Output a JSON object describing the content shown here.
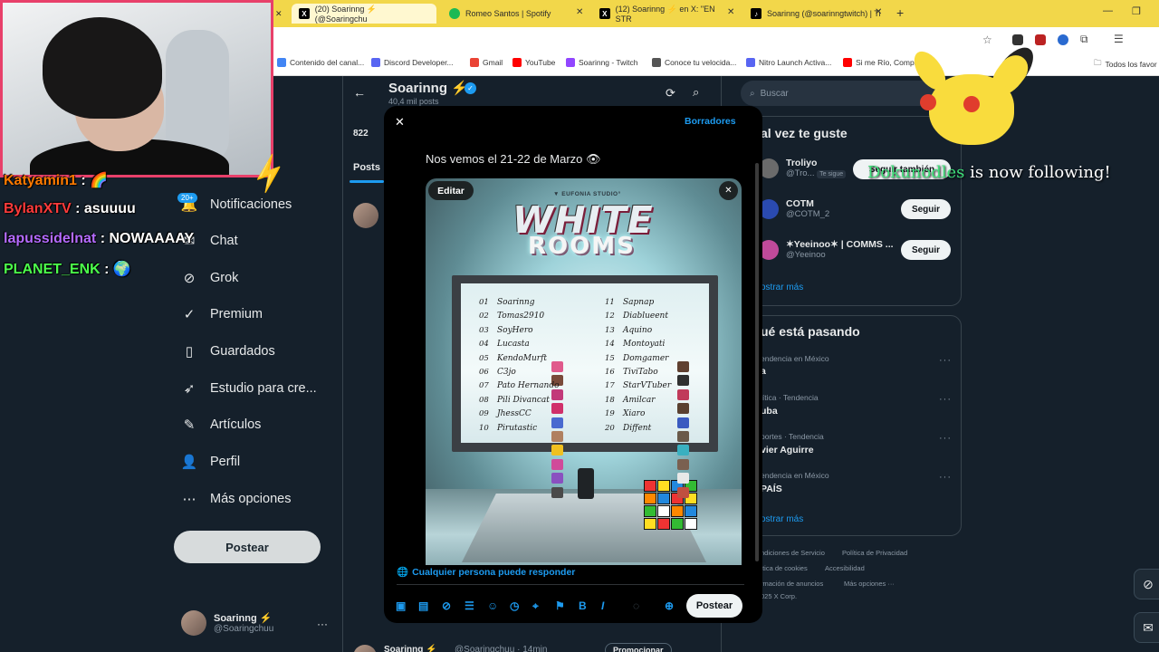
{
  "browser": {
    "tabs": [
      {
        "title": "(20) Soarinng ⚡ (@Soaringchu",
        "icon": "x-icon",
        "color": "#000000"
      },
      {
        "title": "Romeo Santos | Spotify",
        "icon": "spotify-icon",
        "color": "#1db954"
      },
      {
        "title": "(12) Soarinng ⚡ en X: \"EN STR",
        "icon": "x-icon",
        "color": "#000000"
      },
      {
        "title": "Soarinng (@soarinngtwitch) | Ti",
        "icon": "tiktok-icon",
        "color": "#000000"
      }
    ],
    "bookmarks": [
      {
        "label": "Contenido del canal...",
        "color": "#4285f4"
      },
      {
        "label": "Discord Developer...",
        "color": "#5865f2"
      },
      {
        "label": "Gmail",
        "color": "#ea4335"
      },
      {
        "label": "YouTube",
        "color": "#ff0000"
      },
      {
        "label": "Soarinng - Twitch",
        "color": "#9146ff"
      },
      {
        "label": "Conoce tu velocida...",
        "color": "#555555"
      },
      {
        "label": "Nitro Launch Activa...",
        "color": "#5865f2"
      },
      {
        "label": "Si me Río, Compro...",
        "color": "#ff0000"
      }
    ],
    "all_bookmarks": "Todos los favor"
  },
  "sidebar": {
    "items": [
      {
        "label": "Notificaciones",
        "icon": "bell-icon",
        "badge": "20+"
      },
      {
        "label": "Chat",
        "icon": "mail-icon"
      },
      {
        "label": "Grok",
        "icon": "grok-icon"
      },
      {
        "label": "Premium",
        "icon": "verified-icon"
      },
      {
        "label": "Guardados",
        "icon": "bookmark-icon"
      },
      {
        "label": "Estudio para cre...",
        "icon": "rocket-icon"
      },
      {
        "label": "Artículos",
        "icon": "article-icon"
      },
      {
        "label": "Perfil",
        "icon": "person-icon"
      },
      {
        "label": "Más opciones",
        "icon": "more-icon"
      }
    ],
    "post_button": "Postear",
    "profile": {
      "name": "Soarinng ⚡",
      "handle": "@Soaringchuu"
    }
  },
  "profile_header": {
    "name": "Soarinng ⚡",
    "posts_count": "40,4 mil posts",
    "stat": "822",
    "tab": "Posts",
    "bottom_name": "Soarinng ⚡",
    "bottom_handle": "@Soaringchuu · 14min",
    "promote": "Promocionar"
  },
  "right": {
    "search_placeholder": "Buscar",
    "suggest_title": "al vez te guste",
    "suggestions": [
      {
        "name": "Troliyo",
        "handle": "@Tro...",
        "tag": "Te sigue",
        "button": "Seguir también"
      },
      {
        "name": "COTM",
        "handle": "@COTM_2",
        "button": "Seguir"
      },
      {
        "name": "✶Yeeinoo✶ | COMMS ...",
        "handle": "@Yeeinoo",
        "button": "Seguir"
      }
    ],
    "show_more": "ostrar más",
    "trends_title": "ué está pasando",
    "trends": [
      {
        "meta": "endencia en México",
        "name": "a"
      },
      {
        "meta": "lítica · Tendencia",
        "name": "uba"
      },
      {
        "meta": "portes · Tendencia",
        "name": "vier Aguirre"
      },
      {
        "meta": "endencia en México",
        "name": "PAÍS"
      }
    ],
    "trends_more": "ostrar más",
    "footer": [
      "ndiciones de Servicio",
      "Política de Privacidad",
      "ítica de cookies",
      "Accesibilidad",
      "rmación de anuncios",
      "Más opciones ···",
      "025 X Corp."
    ]
  },
  "modal": {
    "drafts": "Borradores",
    "text": "Nos vemos el 21-22 de Marzo 👁",
    "edit": "Editar",
    "reply_setting": "Cualquier persona puede responder",
    "post_button": "Postear",
    "image": {
      "studio": "▼ EUFONIA STUDIO°",
      "logo_line1": "WHITE",
      "logo_line2": "ROOMS",
      "left_list": [
        {
          "n": "01",
          "name": "Soarinng",
          "c": "#e05a8c"
        },
        {
          "n": "02",
          "name": "Tomas2910",
          "c": "#7a4a3a"
        },
        {
          "n": "03",
          "name": "SoyHero",
          "c": "#c23a7a"
        },
        {
          "n": "04",
          "name": "Lucasta",
          "c": "#d0306a"
        },
        {
          "n": "05",
          "name": "KendoMurft",
          "c": "#4a6ad0"
        },
        {
          "n": "06",
          "name": "C3jo",
          "c": "#b08060"
        },
        {
          "n": "07",
          "name": "Pato Hernando",
          "c": "#f0c020"
        },
        {
          "n": "08",
          "name": "Pili Divancat",
          "c": "#d04a9a"
        },
        {
          "n": "09",
          "name": "JhessCC",
          "c": "#8a50c0"
        },
        {
          "n": "10",
          "name": "Pirutastic",
          "c": "#4a4a4a"
        }
      ],
      "right_list": [
        {
          "n": "11",
          "name": "Sapnap",
          "c": "#604030"
        },
        {
          "n": "12",
          "name": "Diablueent",
          "c": "#303030"
        },
        {
          "n": "13",
          "name": "Aquino",
          "c": "#c03a5a"
        },
        {
          "n": "14",
          "name": "Montoyati",
          "c": "#5a4030"
        },
        {
          "n": "15",
          "name": "Domgamer",
          "c": "#3a5ac0"
        },
        {
          "n": "16",
          "name": "TiviTabo",
          "c": "#6a5a4a"
        },
        {
          "n": "17",
          "name": "StarVTuber",
          "c": "#3ab0c0"
        },
        {
          "n": "18",
          "name": "Amilcar",
          "c": "#7a6050"
        },
        {
          "n": "19",
          "name": "Xiaro",
          "c": "#e8e8e8"
        },
        {
          "n": "20",
          "name": "Diffent",
          "c": "#c05040"
        }
      ]
    }
  },
  "overlay": {
    "chat": [
      {
        "user": "Katyamin1",
        "msg": " : 🌈",
        "color": "#ff7a00"
      },
      {
        "user": "BylanXTV",
        "msg": " : asuuuu",
        "color": "#ff3b3b"
      },
      {
        "user": "lapussidelnat",
        "msg": " : NOWAAAAY",
        "color": "#b46bff"
      },
      {
        "user": "PLANET_ENK",
        "msg": " : 🌍",
        "color": "#4cff4c"
      }
    ],
    "follow_user": "Dokunodles",
    "follow_text": " is now following!"
  }
}
